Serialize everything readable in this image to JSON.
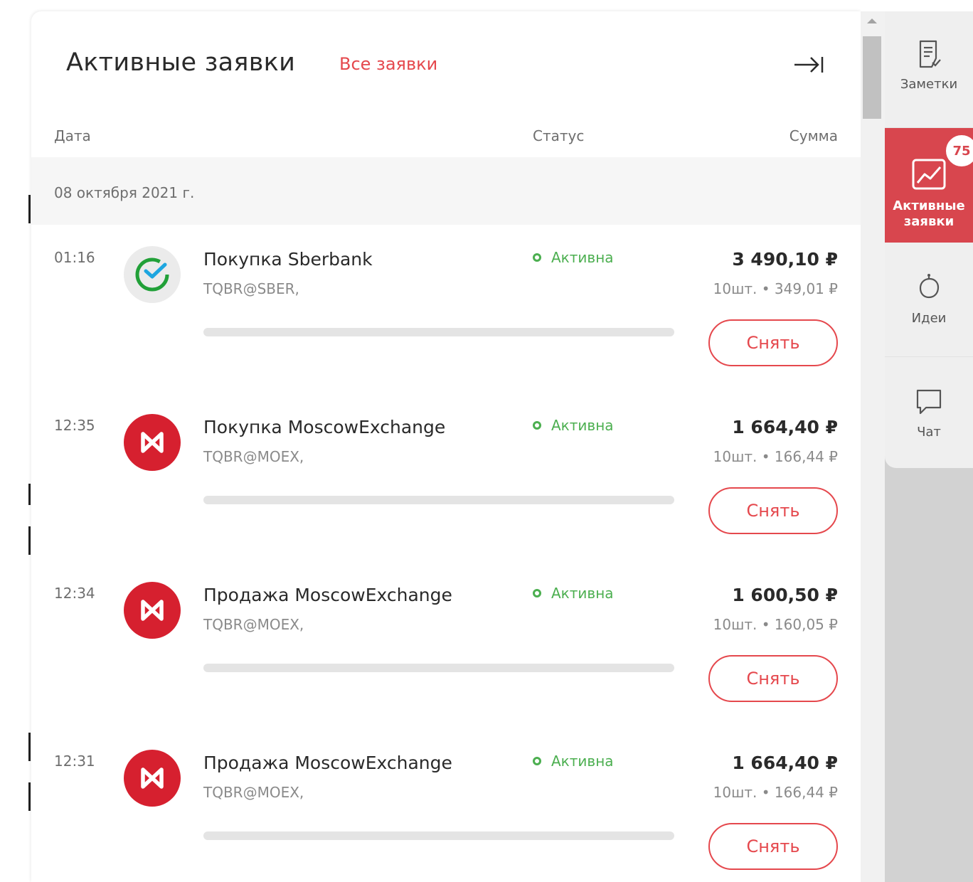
{
  "panel": {
    "title": "Активные заявки",
    "all_orders_link": "Все заявки"
  },
  "columns": {
    "date": "Дата",
    "status": "Статус",
    "sum": "Сумма"
  },
  "date_group": "08 октября 2021 г.",
  "orders": [
    {
      "time": "01:16",
      "name": "Покупка Sberbank",
      "ticker": "TQBR@SBER,",
      "status": "Активна",
      "amount": "3 490,10 ₽",
      "detail": "10шт. • 349,01 ₽",
      "cancel_label": "Снять",
      "logo": "sberbank-logo",
      "progress": 0
    },
    {
      "time": "12:35",
      "name": "Покупка MoscowExchange",
      "ticker": "TQBR@MOEX,",
      "status": "Активна",
      "amount": "1 664,40 ₽",
      "detail": "10шт. • 166,44 ₽",
      "cancel_label": "Снять",
      "logo": "moex-logo",
      "progress": 0
    },
    {
      "time": "12:34",
      "name": "Продажа MoscowExchange",
      "ticker": "TQBR@MOEX,",
      "status": "Активна",
      "amount": "1 600,50 ₽",
      "detail": "10шт. • 160,05 ₽",
      "cancel_label": "Снять",
      "logo": "moex-logo",
      "progress": 0
    },
    {
      "time": "12:31",
      "name": "Продажа MoscowExchange",
      "ticker": "TQBR@MOEX,",
      "status": "Активна",
      "amount": "1 664,40 ₽",
      "detail": "10шт. • 166,44 ₽",
      "cancel_label": "Снять",
      "logo": "moex-logo",
      "progress": 0
    }
  ],
  "sidebar": {
    "items": [
      {
        "label": "Заметки",
        "icon": "notes-icon"
      },
      {
        "label": "Активные\nзаявки",
        "icon": "chart-trend-icon",
        "badge": "75",
        "active": true
      },
      {
        "label": "Идеи",
        "icon": "piggy-bank-icon"
      },
      {
        "label": "Чат",
        "icon": "chat-icon"
      }
    ]
  },
  "colors": {
    "accent": "#e5484d",
    "sidebar_active": "#d8464e",
    "status_active": "#4caf50",
    "moex_red": "#d6202f",
    "sber_green": "#21a038"
  }
}
